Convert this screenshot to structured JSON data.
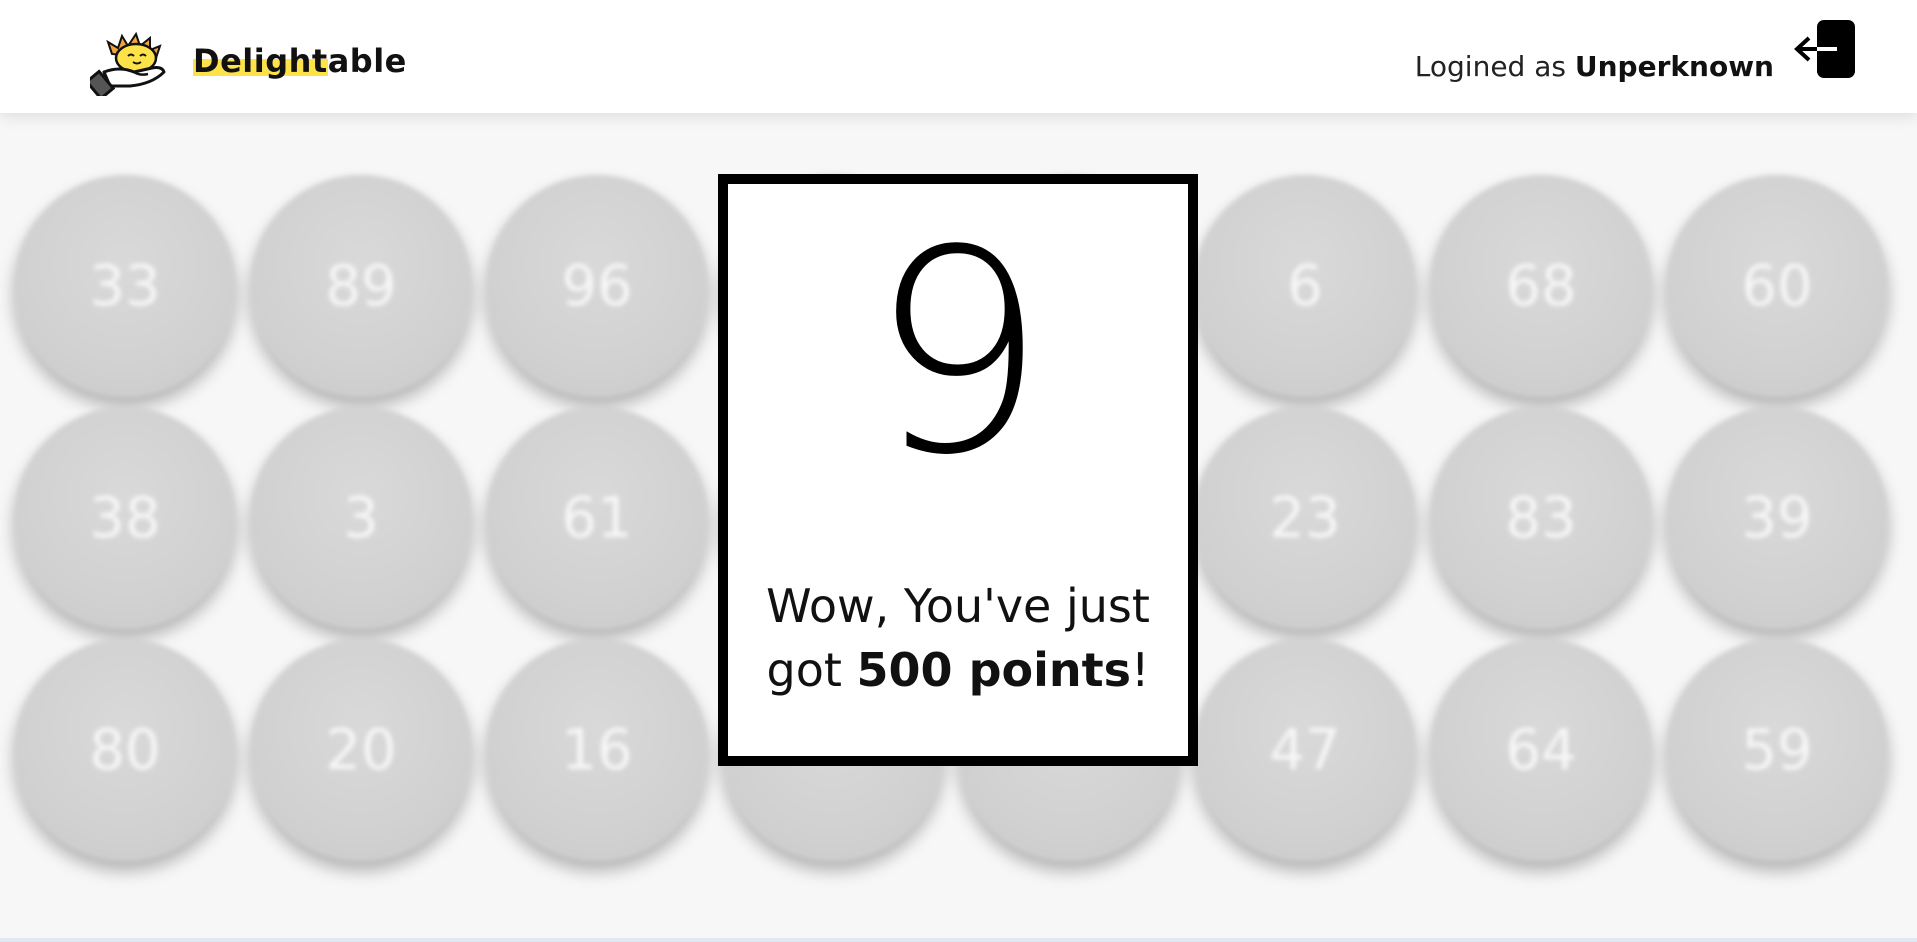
{
  "header": {
    "brand_highlight": "Delight",
    "brand_rest": "able",
    "user_prefix": "Logined as",
    "user_name": "Unperknown",
    "logo_icon": "sun-hand-logo-icon",
    "logout_icon": "logout-arrow-icon"
  },
  "balls": [
    "33",
    "89",
    "96",
    "6",
    "68",
    "60",
    "38",
    "3",
    "61",
    "23",
    "83",
    "39",
    "80",
    "20",
    "16",
    "47",
    "64",
    "59"
  ],
  "modal": {
    "number": "9",
    "msg_prefix": "Wow, You've just got ",
    "msg_points": "500 points",
    "msg_suffix": "!"
  },
  "colors": {
    "accent": "#fde24a",
    "ball": "#d3d3d3",
    "ball_text": "#f7f7f7",
    "card_border": "#000000"
  }
}
